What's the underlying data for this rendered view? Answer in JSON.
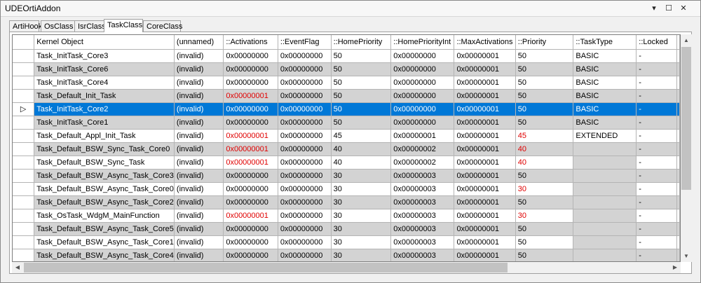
{
  "window": {
    "title": "UDEOrtiAddon",
    "controls": [
      "▾",
      "☐",
      "✕"
    ]
  },
  "tabs": [
    {
      "label": "ArtiHook"
    },
    {
      "label": "OsClass"
    },
    {
      "label": "IsrClass"
    },
    {
      "label": "TaskClass",
      "active": true
    },
    {
      "label": "CoreClass"
    }
  ],
  "grid": {
    "columns": [
      "Kernel Object",
      "(unnamed)",
      "::Activations",
      "::EventFlag",
      "::HomePriority",
      "::HomePriorityInt",
      "::MaxActivations",
      "::Priority",
      "::TaskType",
      "::Locked"
    ],
    "selected_indicator": "▷",
    "rows": [
      [
        "Task_InitTask_Core3",
        "(invalid)",
        "0x00000000",
        "0x00000000",
        "50",
        "0x00000000",
        "0x00000001",
        "50",
        "BASIC",
        "-"
      ],
      [
        "Task_InitTask_Core6",
        "(invalid)",
        "0x00000000",
        "0x00000000",
        "50",
        "0x00000000",
        "0x00000001",
        "50",
        "BASIC",
        "-"
      ],
      [
        "Task_InitTask_Core4",
        "(invalid)",
        "0x00000000",
        "0x00000000",
        "50",
        "0x00000000",
        "0x00000001",
        "50",
        "BASIC",
        "-"
      ],
      [
        "Task_Default_Init_Task",
        "(invalid)",
        "0x00000001",
        "0x00000000",
        "50",
        "0x00000000",
        "0x00000001",
        "50",
        "BASIC",
        "-"
      ],
      [
        "Task_InitTask_Core2",
        "(invalid)",
        "0x00000000",
        "0x00000000",
        "50",
        "0x00000000",
        "0x00000001",
        "50",
        "BASIC",
        "-"
      ],
      [
        "Task_InitTask_Core1",
        "(invalid)",
        "0x00000000",
        "0x00000000",
        "50",
        "0x00000000",
        "0x00000001",
        "50",
        "BASIC",
        "-"
      ],
      [
        "Task_Default_Appl_Init_Task",
        "(invalid)",
        "0x00000001",
        "0x00000000",
        "45",
        "0x00000001",
        "0x00000001",
        "45",
        "EXTENDED",
        "-"
      ],
      [
        "Task_Default_BSW_Sync_Task_Core0",
        "(invalid)",
        "0x00000001",
        "0x00000000",
        "40",
        "0x00000002",
        "0x00000001",
        "40",
        "",
        "-"
      ],
      [
        "Task_Default_BSW_Sync_Task",
        "(invalid)",
        "0x00000001",
        "0x00000000",
        "40",
        "0x00000002",
        "0x00000001",
        "40",
        "",
        "-"
      ],
      [
        "Task_Default_BSW_Async_Task_Core3",
        "(invalid)",
        "0x00000000",
        "0x00000000",
        "30",
        "0x00000003",
        "0x00000001",
        "50",
        "",
        "-"
      ],
      [
        "Task_Default_BSW_Async_Task_Core0",
        "(invalid)",
        "0x00000000",
        "0x00000000",
        "30",
        "0x00000003",
        "0x00000001",
        "30",
        "",
        "-"
      ],
      [
        "Task_Default_BSW_Async_Task_Core2",
        "(invalid)",
        "0x00000000",
        "0x00000000",
        "30",
        "0x00000003",
        "0x00000001",
        "50",
        "",
        "-"
      ],
      [
        "Task_OsTask_WdgM_MainFunction",
        "(invalid)",
        "0x00000001",
        "0x00000000",
        "30",
        "0x00000003",
        "0x00000001",
        "30",
        "",
        "-"
      ],
      [
        "Task_Default_BSW_Async_Task_Core5",
        "(invalid)",
        "0x00000000",
        "0x00000000",
        "30",
        "0x00000003",
        "0x00000001",
        "50",
        "",
        "-"
      ],
      [
        "Task_Default_BSW_Async_Task_Core1",
        "(invalid)",
        "0x00000000",
        "0x00000000",
        "30",
        "0x00000003",
        "0x00000001",
        "50",
        "",
        "-"
      ],
      [
        "Task_Default_BSW_Async_Task_Core4",
        "(invalid)",
        "0x00000000",
        "0x00000000",
        "30",
        "0x00000003",
        "0x00000001",
        "50",
        "",
        "-"
      ]
    ],
    "selected_row": 4,
    "red_cells": [
      [
        3,
        2
      ],
      [
        6,
        2
      ],
      [
        6,
        7
      ],
      [
        7,
        2
      ],
      [
        7,
        7
      ],
      [
        8,
        2
      ],
      [
        8,
        7
      ],
      [
        10,
        7
      ],
      [
        12,
        2
      ],
      [
        12,
        7
      ]
    ],
    "blank_cells": [
      [
        7,
        8
      ],
      [
        8,
        8
      ],
      [
        9,
        8
      ],
      [
        10,
        8
      ],
      [
        11,
        8
      ],
      [
        12,
        8
      ],
      [
        13,
        8
      ],
      [
        14,
        8
      ],
      [
        15,
        8
      ]
    ]
  },
  "colors": {
    "selection": "#0078d7",
    "alt_row": "#d3d3d3",
    "changed_value": "#e00000"
  }
}
